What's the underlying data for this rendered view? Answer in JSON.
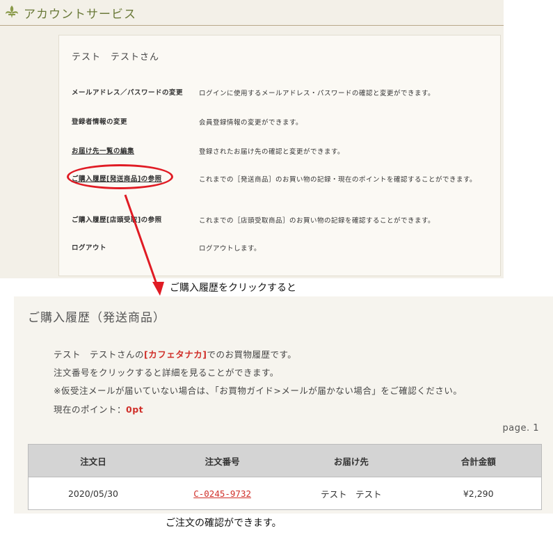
{
  "header": {
    "title": "アカウントサービス"
  },
  "account": {
    "user_name": "テスト　テストさん",
    "menu": [
      {
        "label": "メールアドレス／パスワードの変更",
        "desc": "ログインに使用するメールアドレス・パスワードの確認と変更ができます。"
      },
      {
        "label": "登録者情報の変更",
        "desc": "会員登録情報の変更ができます。"
      },
      {
        "label": "お届け先一覧の編集",
        "desc": "登録されたお届け先の確認と変更ができます。"
      },
      {
        "label": "ご購入履歴[発送商品]の参照",
        "desc": "これまでの［発送商品］のお買い物の記録・現在のポイントを確認することができます。"
      },
      {
        "label": "ご購入履歴[店頭受取]の参照",
        "desc": "これまでの［店頭受取商品］のお買い物の記録を確認することができます。"
      },
      {
        "label": "ログアウト",
        "desc": "ログアウトします。"
      }
    ]
  },
  "caption_click": "ご購入履歴をクリックすると",
  "history": {
    "title": "ご購入履歴（発送商品）",
    "line1_prefix": "テスト　テストさんの",
    "shop_name": "[カフェタナカ]",
    "line1_suffix": "でのお買物履歴です。",
    "line2": "注文番号をクリックすると詳細を見ることができます。",
    "line3": "※仮受注メールが届いていない場合は、「お買物ガイド>メールが届かない場合」をご確認ください。",
    "points_label": "現在のポイント：",
    "points_value": "0pt",
    "page_label": "page. 1",
    "columns": [
      "注文日",
      "注文番号",
      "お届け先",
      "合計金額"
    ],
    "rows": [
      {
        "date": "2020/05/30",
        "order_no": "C-0245-9732",
        "recipient": "テスト　テスト",
        "total": "¥2,290"
      }
    ]
  },
  "caption_confirm": "ご注文の確認ができます。",
  "colors": {
    "accent_red": "#e01b24",
    "link_red": "#d0302a",
    "header_green": "#6b7a3a"
  },
  "icons": {
    "logo": "fleur-de-lis-icon"
  }
}
